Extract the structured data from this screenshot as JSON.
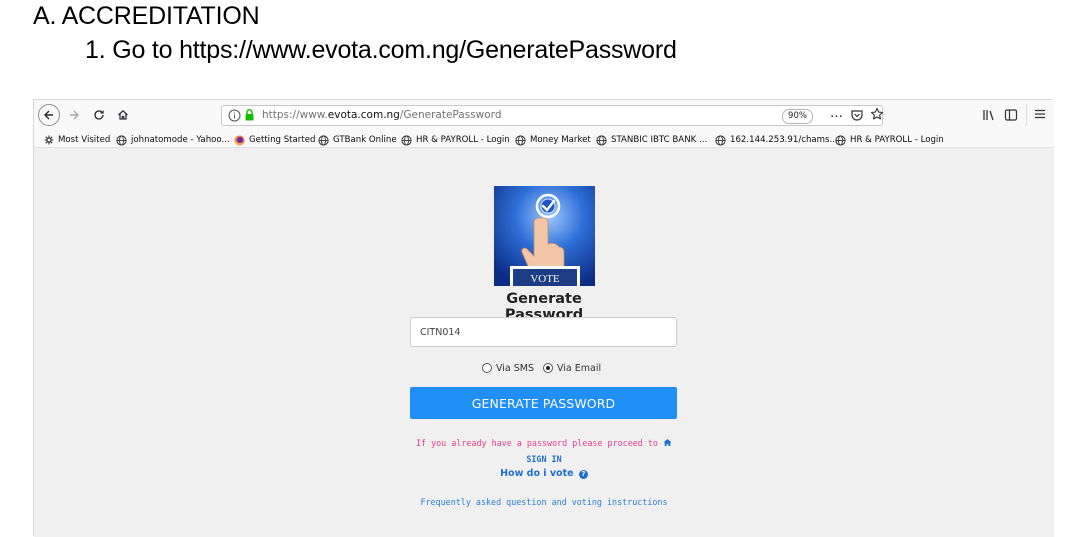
{
  "document": {
    "heading": "A. ACCREDITATION",
    "step": "1. Go to https://www.evota.com.ng/GeneratePassword"
  },
  "browser": {
    "url_prefix": "https://www.",
    "url_domain": "evota.com.ng",
    "url_path": "/GeneratePassword",
    "zoom": "90%",
    "page_actions": "…",
    "bookmarks": [
      {
        "label": "Most Visited",
        "icon": "gear-icon"
      },
      {
        "label": "johnatomode - Yahoo...",
        "icon": "globe-icon"
      },
      {
        "label": "Getting Started",
        "icon": "firefox-icon"
      },
      {
        "label": "GTBank Online",
        "icon": "globe-icon"
      },
      {
        "label": "HR & PAYROLL - Login",
        "icon": "globe-icon"
      },
      {
        "label": "Money Market",
        "icon": "globe-icon"
      },
      {
        "label": "STANBIC IBTC BANK ...",
        "icon": "globe-icon"
      },
      {
        "label": "162.144.253.91/chams...",
        "icon": "globe-icon"
      },
      {
        "label": "HR & PAYROLL - Login",
        "icon": "globe-icon"
      }
    ]
  },
  "page": {
    "logo_caption": "VOTE",
    "title": "Generate Password",
    "user_id_value": "CITN014",
    "radio_sms": "Via SMS",
    "radio_email": "Via Email",
    "selected_option": "Via Email",
    "button_label": "GENERATE PASSWORD",
    "signin_prompt": "If you already have a password please proceed to",
    "signin_link": "SIGN IN",
    "how_to_vote": "How do i vote",
    "faq_link": "Frequently asked question and voting instructions"
  },
  "colors": {
    "primary_button": "#1f8ef5",
    "link": "#1f6fd1",
    "prompt_text": "#e83e8c",
    "page_background": "#f0f0f0",
    "lock_green": "#12bc00"
  }
}
